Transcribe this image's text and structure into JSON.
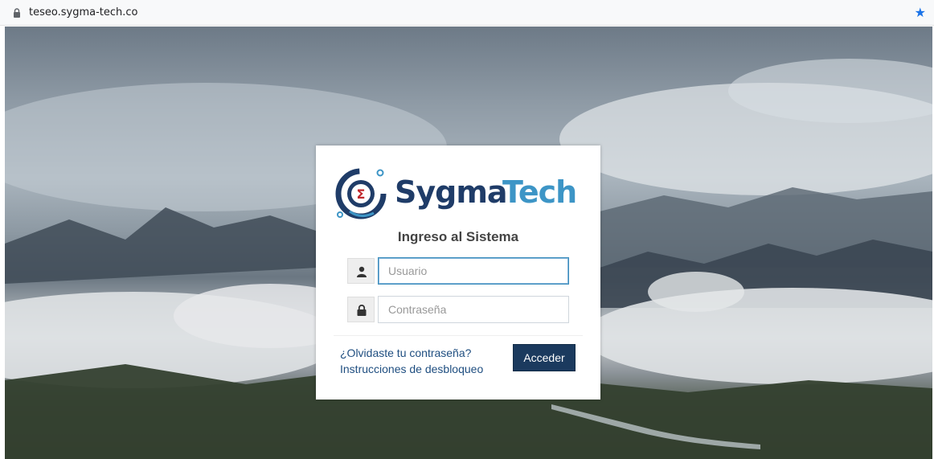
{
  "browser": {
    "url": "teseo.sygma-tech.co",
    "lock_icon": "lock-icon",
    "bookmark_icon": "star-icon",
    "bookmark_color": "#1a73e8"
  },
  "login": {
    "logo": {
      "word1": "Sygma",
      "word2": "Tech",
      "color_dark": "#1f3c68",
      "color_light": "#3d95c6"
    },
    "title": "Ingreso al Sistema",
    "username": {
      "placeholder": "Usuario",
      "value": "",
      "icon": "user-icon"
    },
    "password": {
      "placeholder": "Contraseña",
      "value": "",
      "icon": "lock-icon"
    },
    "forgot_link": "¿Olvidaste tu contraseña?",
    "unlock_link": "Instrucciones de desbloqueo",
    "submit_label": "Acceder",
    "submit_color": "#1b3a5e"
  }
}
